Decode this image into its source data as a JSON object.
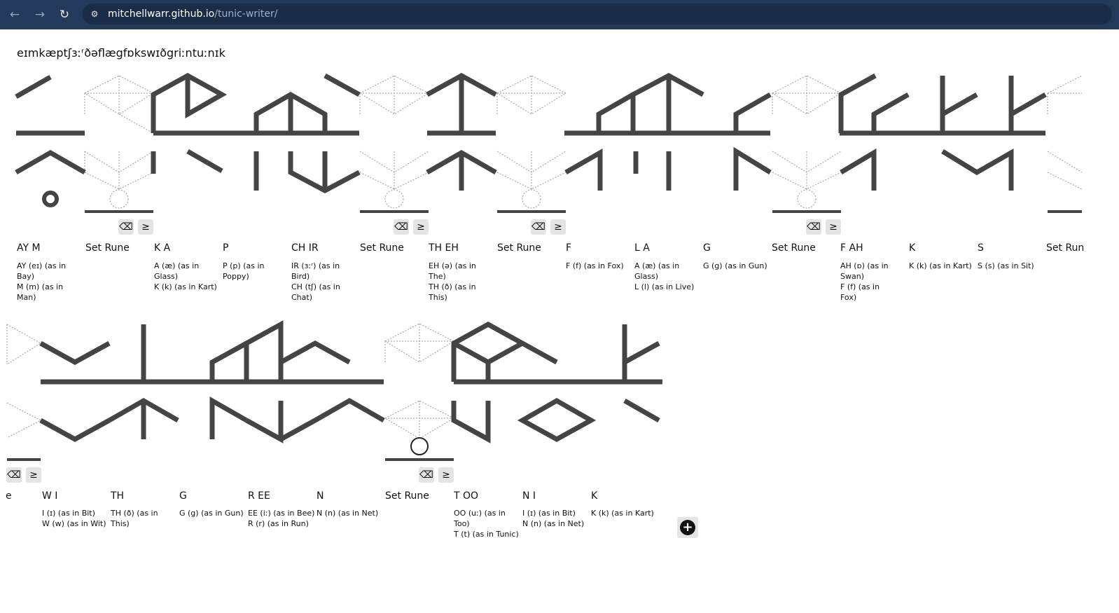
{
  "browser": {
    "back_icon": "arrow-left-icon",
    "forward_icon": "arrow-right-icon",
    "reload_icon": "reload-icon",
    "url_host": "mitchellwarr.github.io",
    "url_path": "/tunic-writer/"
  },
  "phrase": {
    "ipa": "eɪmkæptʃɜːʳðəflægfɒkswɪðgriːntuːnɪk"
  },
  "colors": {
    "stroke": "#444444",
    "topbar": "#233a5a",
    "guide": "#999999"
  },
  "row1": {
    "runes": [
      {
        "word": "AY M",
        "lines": [
          "AY (eɪ) (as in Bay)",
          "M (m) (as in Man)"
        ]
      },
      {
        "word": "Set Rune",
        "lines": []
      },
      {
        "word": "K A",
        "lines": [
          "A (æ) (as in Glass)",
          "K (k) (as in Kart)"
        ]
      },
      {
        "word": "P",
        "lines": [
          "P (p) (as in Poppy)"
        ]
      },
      {
        "word": "CH IR",
        "lines": [
          "IR (ɜːʳ) (as in Bird)",
          "CH (tʃ) (as in Chat)"
        ]
      },
      {
        "word": "Set Rune",
        "lines": []
      },
      {
        "word": "TH EH",
        "lines": [
          "EH (ə) (as in The)",
          "TH (ð) (as in This)"
        ]
      },
      {
        "word": "Set Rune",
        "lines": []
      },
      {
        "word": "F",
        "lines": [
          "F (f) (as in Fox)"
        ]
      },
      {
        "word": "L A",
        "lines": [
          "A (æ) (as in Glass)",
          "L (l) (as in Live)"
        ]
      },
      {
        "word": "G",
        "lines": [
          "G (g) (as in Gun)"
        ]
      },
      {
        "word": "Set Rune",
        "lines": []
      },
      {
        "word": "F AH",
        "lines": [
          "AH (ɒ) (as in Swan)",
          "F (f) (as in Fox)"
        ]
      },
      {
        "word": "K",
        "lines": [
          "K (k) (as in Kart)"
        ]
      },
      {
        "word": "S",
        "lines": [
          "S (s) (as in Sit)"
        ]
      },
      {
        "word": "Set Run",
        "lines": []
      }
    ]
  },
  "row2": {
    "runes": [
      {
        "word": "e",
        "lines": []
      },
      {
        "word": "W I",
        "lines": [
          "I (ɪ) (as in Bit)",
          "W (w) (as in Wit)"
        ]
      },
      {
        "word": "TH",
        "lines": [
          "TH (ð) (as in This)"
        ]
      },
      {
        "word": "G",
        "lines": [
          "G (g) (as in Gun)"
        ]
      },
      {
        "word": "R EE",
        "lines": [
          "EE (iː) (as in Bee)",
          "R (r) (as in Run)"
        ]
      },
      {
        "word": "N",
        "lines": [
          "N (n) (as in Net)"
        ]
      },
      {
        "word": "Set Rune",
        "lines": []
      },
      {
        "word": "T OO",
        "lines": [
          "OO (uː) (as in Too)",
          "T (t) (as in Tunic)"
        ]
      },
      {
        "word": "N I",
        "lines": [
          "I (ɪ) (as in Bit)",
          "N (n) (as in Net)"
        ]
      },
      {
        "word": "K",
        "lines": [
          "K (k) (as in Kart)"
        ]
      }
    ]
  },
  "controls": {
    "delete_label": "⌫",
    "next_label": "≥",
    "delete_icon": "backspace-icon",
    "next_icon": "greater-equal-icon",
    "add_label": "+",
    "add_icon": "plus-circle-icon"
  }
}
